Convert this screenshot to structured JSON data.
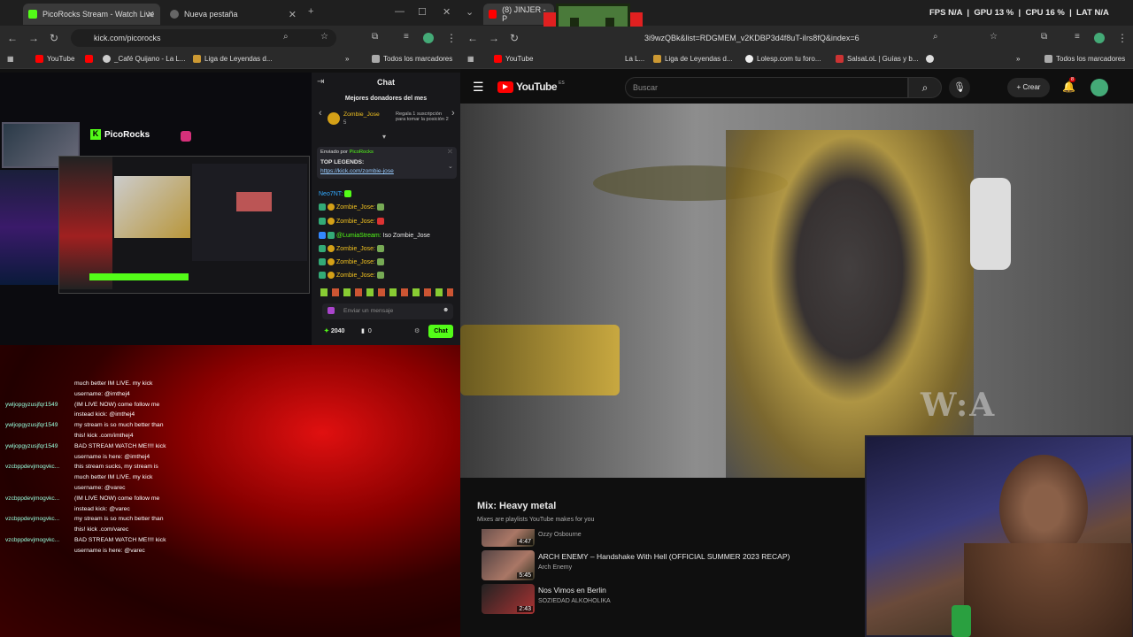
{
  "left_browser": {
    "tabs": [
      {
        "label": "PicoRocks Stream - Watch Live"
      },
      {
        "label": "Nueva pestaña"
      }
    ],
    "url": "kick.com/picorocks",
    "bookmarks": [
      {
        "label": "YouTube"
      },
      {
        "label": "_Café Quijano - La L..."
      },
      {
        "label": "Liga de Leyendas d..."
      },
      {
        "label": "Todos los marcadores"
      }
    ]
  },
  "stream_overlay": {
    "channel": "PicoRocks"
  },
  "chat_panel": {
    "title": "Chat",
    "top_donors_title": "Mejores donadores del mes",
    "top_donor": {
      "name": "Zombie_Jose",
      "count": "5"
    },
    "gift_prompt": "Regala 1 suscripción para tomar la posición 2",
    "pinned_sent_by": "Enviado por",
    "pinned_author": "PicoRocks",
    "pinned_title": "TOP LEGENDS:",
    "pinned_link": "https://kick.com/zombie-jose",
    "messages": [
      {
        "user": "Neo7NT:",
        "text": ""
      },
      {
        "user": "Zombie_Jose:",
        "text": ""
      },
      {
        "user": "Zombie_Jose:",
        "text": ""
      },
      {
        "user": "@LumiaStream:",
        "text": "Iso Zombie_Jose"
      },
      {
        "user": "Zombie_Jose:",
        "text": ""
      },
      {
        "user": "Zombie_Jose:",
        "text": ""
      },
      {
        "user": "Zombie_Jose:",
        "text": ""
      }
    ],
    "input_placeholder": "Enviar un mensaje",
    "points": "2040",
    "viewers": "0",
    "chat_button": "Chat"
  },
  "spam_chat": {
    "lines": [
      {
        "name": "",
        "text": "much better IM LIVE. my kick"
      },
      {
        "name": "",
        "text": "username: @imthej4"
      },
      {
        "name": "ywljopgyzusjfqr1549",
        "text": "(IM LIVE NOW) come follow me"
      },
      {
        "name": "",
        "text": "instead kick: @imthej4"
      },
      {
        "name": "ywljopgyzusjfqr1549",
        "text": "my stream is so much better than"
      },
      {
        "name": "",
        "text": "this! kick .com/imthej4"
      },
      {
        "name": "ywljopgyzusjfqr1549",
        "text": "BAD STREAM WATCH ME!!!! kick"
      },
      {
        "name": "",
        "text": "username is here: @imthej4"
      },
      {
        "name": "vzcbppdevjmogvkc...",
        "text": "this stream sucks, my stream is"
      },
      {
        "name": "",
        "text": "much better IM LIVE. my kick"
      },
      {
        "name": "",
        "text": "username: @varec"
      },
      {
        "name": "vzcbppdevjmogvkc...",
        "text": "(IM LIVE NOW) come follow me"
      },
      {
        "name": "",
        "text": "instead kick: @varec"
      },
      {
        "name": "vzcbppdevjmogvkc...",
        "text": "my stream is so much better than"
      },
      {
        "name": "",
        "text": "this! kick .com/varec"
      },
      {
        "name": "vzcbppdevjmogvkc...",
        "text": "BAD STREAM WATCH ME!!!! kick"
      },
      {
        "name": "",
        "text": "username is here: @varec"
      }
    ]
  },
  "right_browser": {
    "tab_label": "(8) JINJER - P",
    "url": "3i9wzQBk&list=RDGMEM_v2KDBP3d4f8uT-iIrs8fQ&index=6",
    "bookmarks": [
      {
        "label": "YouTube"
      },
      {
        "label": "La L..."
      },
      {
        "label": "Liga de Leyendas d..."
      },
      {
        "label": "Lolesp.com tu foro..."
      },
      {
        "label": "SalsaLoL | Guías y b..."
      },
      {
        "label": "Todos los marcadores"
      }
    ],
    "perf": {
      "fps_label": "FPS",
      "fps_value": "N/A",
      "gpu_label": "GPU",
      "gpu_value": "13 %",
      "cpu_label": "CPU",
      "cpu_value": "16 %",
      "lat_label": "LAT",
      "lat_value": "N/A"
    }
  },
  "youtube": {
    "logo": "YouTube",
    "region": "ES",
    "search_placeholder": "Buscar",
    "create_label": "Crear",
    "notif_count": "8",
    "mix_title": "Mix: Heavy metal",
    "mix_sub": "Mixes are playlists YouTube makes for you",
    "videos": [
      {
        "title": "",
        "channel": "Ozzy Osbourne",
        "duration": "4:47"
      },
      {
        "title": "ARCH ENEMY – Handshake With Hell (OFFICIAL SUMMER 2023 RECAP)",
        "channel": "Arch Enemy",
        "duration": "5:45"
      },
      {
        "title": "Nos Vimos en Berlin",
        "channel": "SOZIEDAD ALKOHOLIKA",
        "duration": "2:43"
      }
    ]
  },
  "colors": {
    "kick_green": "#53fc18",
    "youtube_red": "#ff0000",
    "chat_bg": "#18181b"
  }
}
